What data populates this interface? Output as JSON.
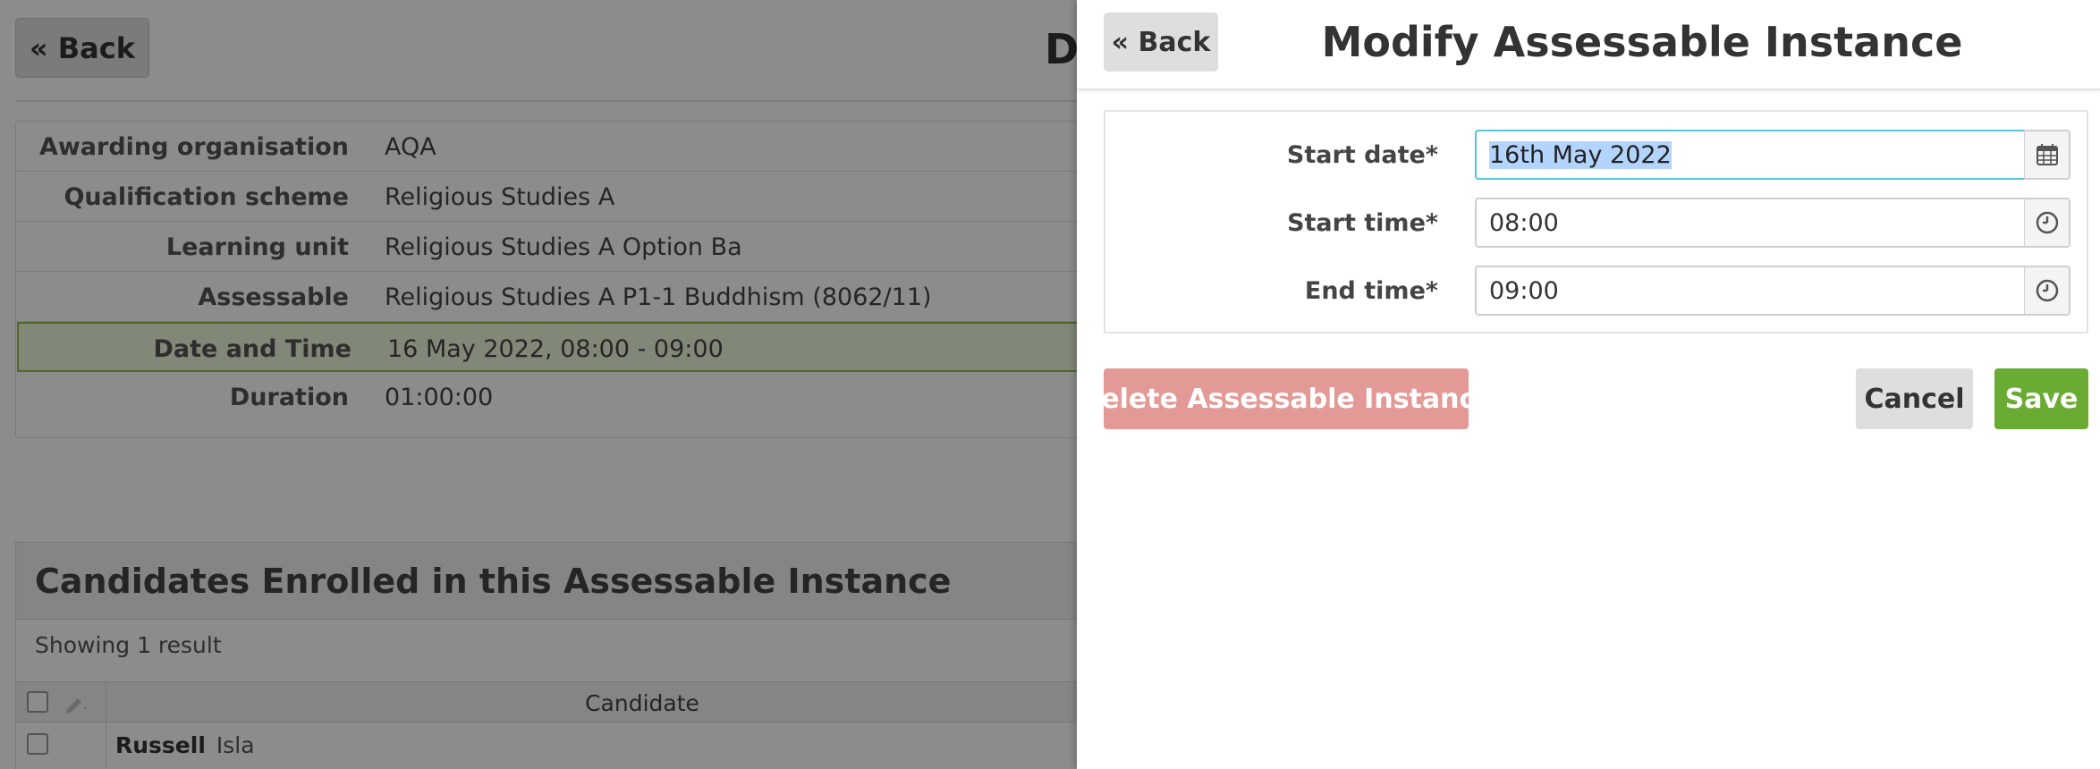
{
  "background_page": {
    "back_label": "« Back",
    "title_partial": "De",
    "details": [
      {
        "label": "Awarding organisation",
        "value": "AQA"
      },
      {
        "label": "Qualification scheme",
        "value": "Religious Studies A"
      },
      {
        "label": "Learning unit",
        "value": "Religious Studies A Option Ba"
      },
      {
        "label": "Assessable",
        "value": "Religious Studies A P1-1 Buddhism (8062/11)"
      },
      {
        "label": "Date and Time",
        "value": "16 May 2022, 08:00 - 09:00"
      },
      {
        "label": "Duration",
        "value": "01:00:00"
      }
    ],
    "candidates": {
      "title": "Candidates Enrolled in this Assessable Instance",
      "showing": "Showing 1 result",
      "column_candidate": "Candidate",
      "rows": [
        {
          "surname": "Russell",
          "first_name": "Isla"
        }
      ]
    }
  },
  "modal": {
    "back_label": "« Back",
    "title": "Modify Assessable Instance",
    "fields": {
      "start_date": {
        "label": "Start date*",
        "value": "16th May 2022",
        "icon": "calendar-icon"
      },
      "start_time": {
        "label": "Start time*",
        "value": "08:00",
        "icon": "clock-icon"
      },
      "end_time": {
        "label": "End time*",
        "value": "09:00",
        "icon": "clock-icon"
      }
    },
    "delete_label": "Delete Assessable Instance",
    "cancel_label": "Cancel",
    "save_label": "Save"
  },
  "colors": {
    "save": "#6aab33",
    "delete": "#e39a96",
    "focus_border": "#57c3d8",
    "highlight_row": "#edf7d9",
    "text_selection": "#b3d4fc"
  }
}
